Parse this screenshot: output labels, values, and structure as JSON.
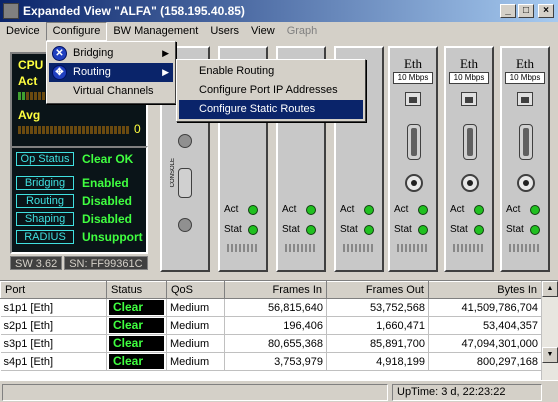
{
  "window": {
    "title": "Expanded View \"ALFA\" (158.195.40.85)"
  },
  "menubar": [
    "Device",
    "Configure",
    "BW Management",
    "Users",
    "View",
    "Graph"
  ],
  "configure_menu": {
    "items": [
      {
        "label": "Bridging",
        "icon": "x-network-icon"
      },
      {
        "label": "Routing",
        "icon": "router-icon"
      },
      {
        "label": "Virtual Channels"
      }
    ]
  },
  "routing_submenu": [
    "Enable Routing",
    "Configure Port IP Addresses",
    "Configure Static Routes"
  ],
  "cpu_panel": {
    "cpu_label": "CPU",
    "act_label": "Act",
    "avg_label": "Avg",
    "avg_value": "0"
  },
  "op_status": [
    {
      "key": "Op Status",
      "value": "Clear OK"
    },
    {
      "key": "Bridging",
      "value": "Enabled"
    },
    {
      "key": "Routing",
      "value": "Disabled"
    },
    {
      "key": "Shaping",
      "value": "Disabled"
    },
    {
      "key": "RADIUS",
      "value": "Unsupport"
    }
  ],
  "version": {
    "sw": "SW 3.62",
    "sn": "SN: FF99361C"
  },
  "modules": {
    "eth_title": "Eth",
    "speed": "10 Mbps",
    "act": "Act",
    "stat": "Stat",
    "console": "CONSOLE"
  },
  "table": {
    "headers": [
      "Port",
      "Status",
      "QoS",
      "Frames In",
      "Frames Out",
      "Bytes In"
    ],
    "rows": [
      {
        "port": "s1p1  [Eth]",
        "status": "Clear",
        "qos": "Medium",
        "frames_in": "56,815,640",
        "frames_out": "53,752,568",
        "bytes_in": "41,509,786,704"
      },
      {
        "port": "s2p1  [Eth]",
        "status": "Clear",
        "qos": "Medium",
        "frames_in": "196,406",
        "frames_out": "1,660,471",
        "bytes_in": "53,404,357"
      },
      {
        "port": "s3p1  [Eth]",
        "status": "Clear",
        "qos": "Medium",
        "frames_in": "80,655,368",
        "frames_out": "85,891,700",
        "bytes_in": "47,094,301,000"
      },
      {
        "port": "s4p1  [Eth]",
        "status": "Clear",
        "qos": "Medium",
        "frames_in": "3,753,979",
        "frames_out": "4,918,199",
        "bytes_in": "800,297,168"
      }
    ]
  },
  "statusbar": {
    "uptime": "UpTime:  3 d, 22:23:22"
  },
  "colors": {
    "highlight": "#0a246a",
    "lcd_green": "#40ff40",
    "lcd_yellow": "#ffff40",
    "lcd_cyan": "#40e0e0"
  }
}
